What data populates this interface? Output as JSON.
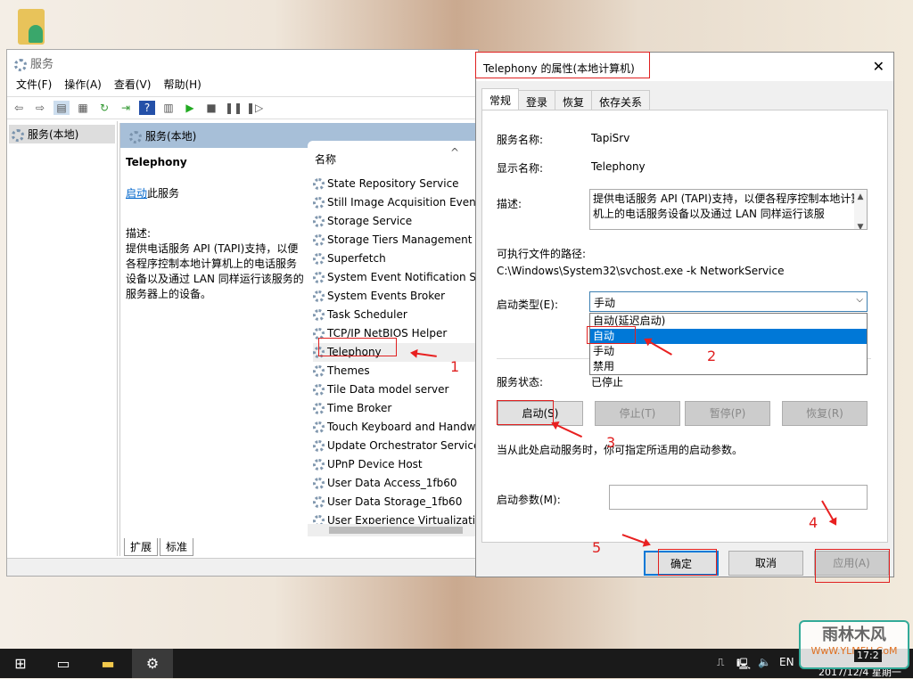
{
  "window": {
    "title": "服务",
    "menu": [
      "文件(F)",
      "操作(A)",
      "查看(V)",
      "帮助(H)"
    ],
    "toolbar_icons": [
      "back-icon",
      "forward-icon",
      "show-hide-tree-icon",
      "properties-icon",
      "refresh-icon",
      "export-icon",
      "help-icon",
      "view-icon",
      "play-icon",
      "stop-icon",
      "pause-icon",
      "resume-icon"
    ],
    "nav_item": "服务(本地)",
    "pane_title": "服务(本地)",
    "selected_service": "Telephony",
    "start_link": "启动",
    "start_suffix": "此服务",
    "desc_label": "描述:",
    "desc_text": "提供电话服务 API (TAPI)支持，以便各程序控制本地计算机上的电话服务设备以及通过 LAN 同样运行该服务的服务器上的设备。",
    "column_name": "名称",
    "services": [
      "State Repository Service",
      "Still Image Acquisition Events",
      "Storage Service",
      "Storage Tiers Management",
      "Superfetch",
      "System Event Notification Service",
      "System Events Broker",
      "Task Scheduler",
      "TCP/IP NetBIOS Helper",
      "Telephony",
      "Themes",
      "Tile Data model server",
      "Time Broker",
      "Touch Keyboard and Handwriting",
      "Update Orchestrator Service",
      "UPnP Device Host",
      "User Data Access_1fb60",
      "User Data Storage_1fb60",
      "User Experience Virtualization"
    ],
    "bottom_tabs": [
      "扩展",
      "标准"
    ]
  },
  "dialog": {
    "title": "Telephony 的属性(本地计算机)",
    "tabs": [
      "常规",
      "登录",
      "恢复",
      "依存关系"
    ],
    "service_name_label": "服务名称:",
    "service_name": "TapiSrv",
    "display_name_label": "显示名称:",
    "display_name": "Telephony",
    "desc_label": "描述:",
    "desc": "提供电话服务 API (TAPI)支持，以便各程序控制本地计算机上的电话服务设备以及通过 LAN 同样运行该服",
    "path_label": "可执行文件的路径:",
    "path": "C:\\Windows\\System32\\svchost.exe -k NetworkService",
    "startup_label": "启动类型(E):",
    "startup_value": "手动",
    "startup_options": [
      "自动(延迟启动)",
      "自动",
      "手动",
      "禁用"
    ],
    "highlighted_option": "自动",
    "status_label": "服务状态:",
    "status": "已停止",
    "buttons": {
      "start": "启动(S)",
      "stop": "停止(T)",
      "pause": "暂停(P)",
      "resume": "恢复(R)"
    },
    "hint": "当从此处启动服务时，你可指定所适用的启动参数。",
    "params_label": "启动参数(M):",
    "params_value": "",
    "ok": "确定",
    "cancel": "取消",
    "apply": "应用(A)"
  },
  "annotations": [
    "1",
    "2",
    "3",
    "4",
    "5"
  ],
  "annotation_color": "#e02020",
  "taskbar": {
    "lang": "EN",
    "time": "17:2",
    "date": "2017/12/4 星期一"
  },
  "watermark": {
    "text": "雨林木风",
    "url": "WwW.YLMFU.CoM"
  }
}
